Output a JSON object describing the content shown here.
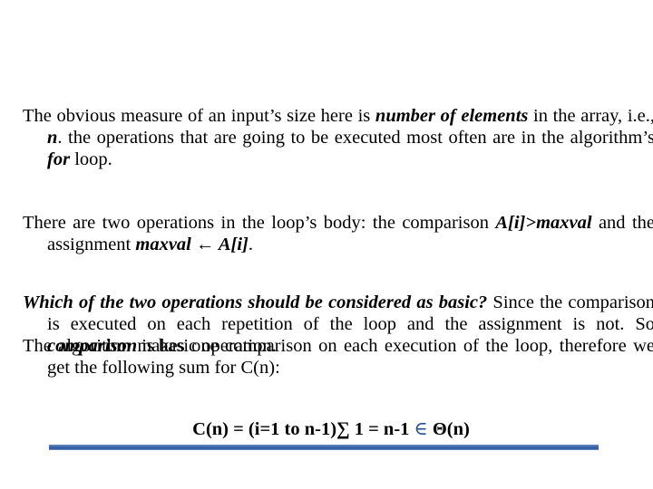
{
  "paragraphs": {
    "p1": {
      "t1": "The obvious measure of an input’s size here is ",
      "b1": "number of elements",
      "t2": " in the array, i.e., ",
      "b2": "n",
      "t3": ". the operations that are going to be executed most often are in the algorithm’s ",
      "b3": "for",
      "t4": " loop."
    },
    "p2": {
      "t1": "There are two operations in the loop’s body: the comparison ",
      "b1": "A[i]>maxval",
      "t2": " and the assignment ",
      "b2": "maxval ← A[i]",
      "t3": "."
    },
    "p3": {
      "b1": "Which of the two operations should be considered as basic?",
      "t1": " Since the comparison is executed on each repetition of the loop and the assignment is not. So ",
      "b2": "comparison",
      "t2": " is basic operation."
    },
    "p4": {
      "t1": "The algorithm makes one comparison on each execution of the loop, therefore we get the following sum for C(n):"
    }
  },
  "formula": {
    "lhs": "C(n) = (i=1 to n-1)∑ 1 = n-1 ",
    "element_of": "∈",
    "rhs": " Θ(n)"
  },
  "colors": {
    "accent_bar": "#3e66ad",
    "element_symbol": "#1f4e9a"
  }
}
